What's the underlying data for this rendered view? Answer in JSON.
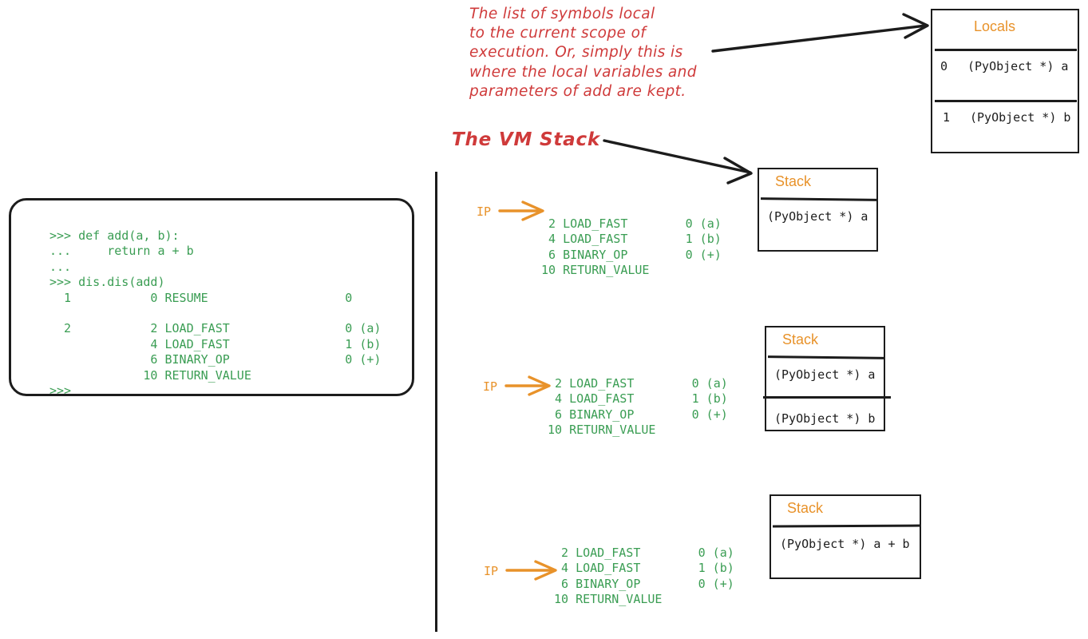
{
  "annotations": {
    "locals_note": "The list of symbols local\nto the current scope of\nexecution. Or, simply this is\nwhere the local variables and\nparameters of add are kept.",
    "vm_stack_label": "The VM Stack"
  },
  "colors": {
    "accent_orange": "#e8922a",
    "code_green": "#3a9d53",
    "annotation_red": "#cf3a3a",
    "ink_black": "#1c1c1c",
    "background": "#ffffff"
  },
  "repl": {
    "code": ">>> def add(a, b):\n...     return a + b\n...\n>>> dis.dis(add)\n  1           0 RESUME                   0\n\n  2           2 LOAD_FAST                0 (a)\n              4 LOAD_FAST                1 (b)\n              6 BINARY_OP                0 (+)\n             10 RETURN_VALUE\n>>>"
  },
  "locals_box": {
    "title": "Locals",
    "rows": [
      {
        "index": "0",
        "value": "(PyObject *) a"
      },
      {
        "index": "1",
        "value": "(PyObject *) b"
      }
    ]
  },
  "frames": [
    {
      "ip_label": "IP",
      "ip_target_offset": "2",
      "bytecode": " 2 LOAD_FAST        0 (a)\n 4 LOAD_FAST        1 (b)\n 6 BINARY_OP        0 (+)\n10 RETURN_VALUE",
      "stack": {
        "title": "Stack",
        "cells": [
          "(PyObject *) a"
        ]
      }
    },
    {
      "ip_label": "IP",
      "ip_target_offset": "4",
      "bytecode": " 2 LOAD_FAST        0 (a)\n 4 LOAD_FAST        1 (b)\n 6 BINARY_OP        0 (+)\n10 RETURN_VALUE",
      "stack": {
        "title": "Stack",
        "cells": [
          "(PyObject *) a",
          "(PyObject *) b"
        ]
      }
    },
    {
      "ip_label": "IP",
      "ip_target_offset": "6",
      "bytecode": " 2 LOAD_FAST        0 (a)\n 4 LOAD_FAST        1 (b)\n 6 BINARY_OP        0 (+)\n10 RETURN_VALUE",
      "stack": {
        "title": "Stack",
        "cells": [
          "(PyObject *) a + b"
        ]
      }
    }
  ]
}
